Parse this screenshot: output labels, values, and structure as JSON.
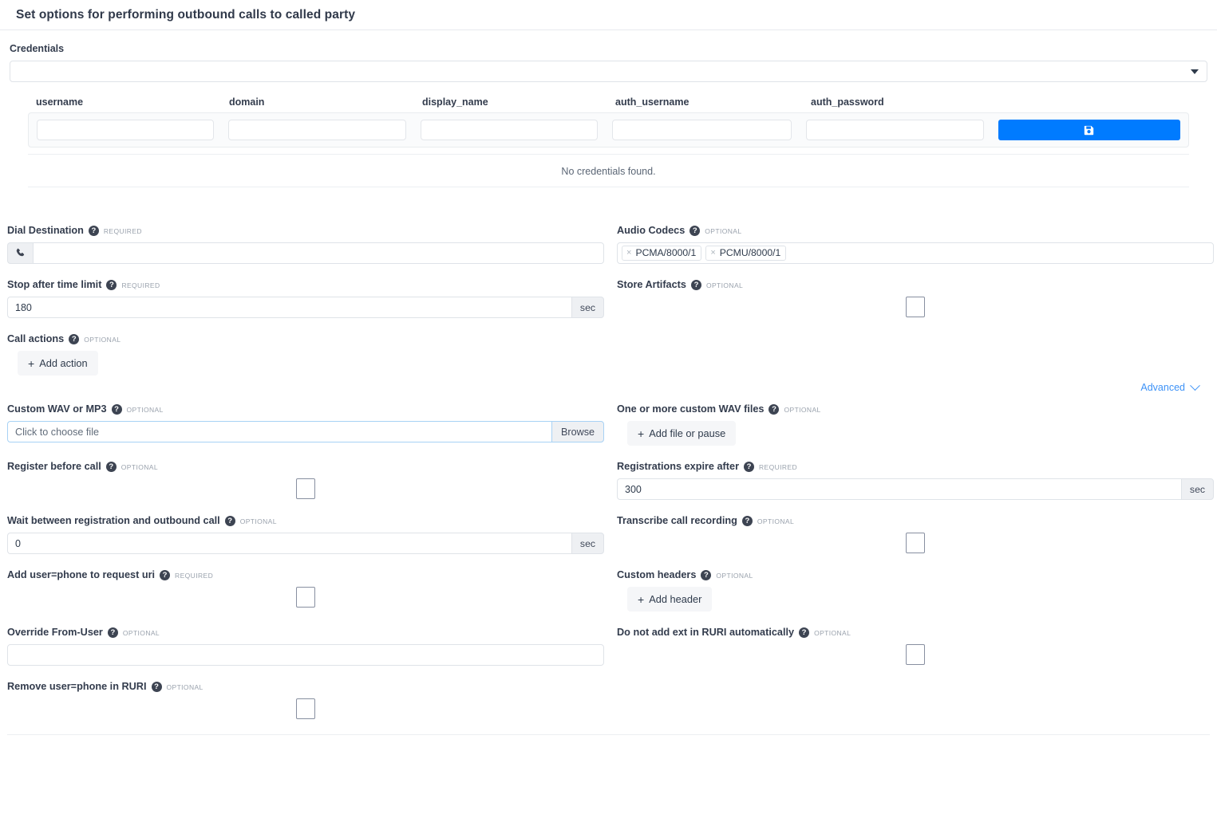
{
  "header": {
    "title": "Set options for performing outbound calls to called party"
  },
  "credentials": {
    "label": "Credentials",
    "select_value": "",
    "columns": [
      "username",
      "domain",
      "display_name",
      "auth_username",
      "auth_password"
    ],
    "row_values": [
      "",
      "",
      "",
      "",
      ""
    ],
    "save_icon": "save-floppy-icon",
    "empty_message": "No credentials found.",
    "caret_icon": "chevron-down-icon"
  },
  "badges": {
    "required": "REQUIRED",
    "optional": "OPTIONAL"
  },
  "help_icon_glyph": "?",
  "advanced": {
    "label": "Advanced",
    "icon": "chevron-down-icon"
  },
  "fields": {
    "dial_destination": {
      "label": "Dial Destination",
      "badge": "REQUIRED",
      "value": "",
      "prefix_icon": "phone-icon"
    },
    "audio_codecs": {
      "label": "Audio Codecs",
      "badge": "OPTIONAL",
      "tags": [
        "PCMA/8000/1",
        "PCMU/8000/1"
      ],
      "remove_glyph": "×"
    },
    "stop_after_time_limit": {
      "label": "Stop after time limit",
      "badge": "REQUIRED",
      "value": "180",
      "unit": "sec"
    },
    "store_artifacts": {
      "label": "Store Artifacts",
      "badge": "OPTIONAL",
      "checked": false
    },
    "call_actions": {
      "label": "Call actions",
      "badge": "OPTIONAL",
      "button_label": "Add action",
      "plus": "+"
    },
    "custom_wav_or_mp3": {
      "label": "Custom WAV or MP3",
      "badge": "OPTIONAL",
      "placeholder": "Click to choose file",
      "browse_label": "Browse"
    },
    "custom_wav_files": {
      "label": "One or more custom WAV files",
      "badge": "OPTIONAL",
      "button_label": "Add file or pause",
      "plus": "+"
    },
    "register_before_call": {
      "label": "Register before call",
      "badge": "OPTIONAL",
      "checked": false
    },
    "registrations_expire_after": {
      "label": "Registrations expire after",
      "badge": "REQUIRED",
      "value": "300",
      "unit": "sec"
    },
    "wait_between_registration": {
      "label": "Wait between registration and outbound call",
      "badge": "OPTIONAL",
      "value": "0",
      "unit": "sec"
    },
    "transcribe_call_recording": {
      "label": "Transcribe call recording",
      "badge": "OPTIONAL",
      "checked": false
    },
    "add_user_phone_to_request_uri": {
      "label": "Add user=phone to request uri",
      "badge": "REQUIRED",
      "checked": false
    },
    "custom_headers": {
      "label": "Custom headers",
      "badge": "OPTIONAL",
      "button_label": "Add header",
      "plus": "+"
    },
    "override_from_user": {
      "label": "Override From-User",
      "badge": "OPTIONAL",
      "value": ""
    },
    "do_not_add_ext_in_ruri": {
      "label": "Do not add ext in RURI automatically",
      "badge": "OPTIONAL",
      "checked": false
    },
    "remove_user_phone_in_ruri": {
      "label": "Remove user=phone in RURI",
      "badge": "OPTIONAL",
      "checked": false
    }
  },
  "colors": {
    "accent_blue": "#007bff",
    "link_blue": "#3d92f7",
    "text_dark": "#333c4d",
    "badge_gray": "#9aa2ad",
    "border": "#dfe3e8"
  }
}
